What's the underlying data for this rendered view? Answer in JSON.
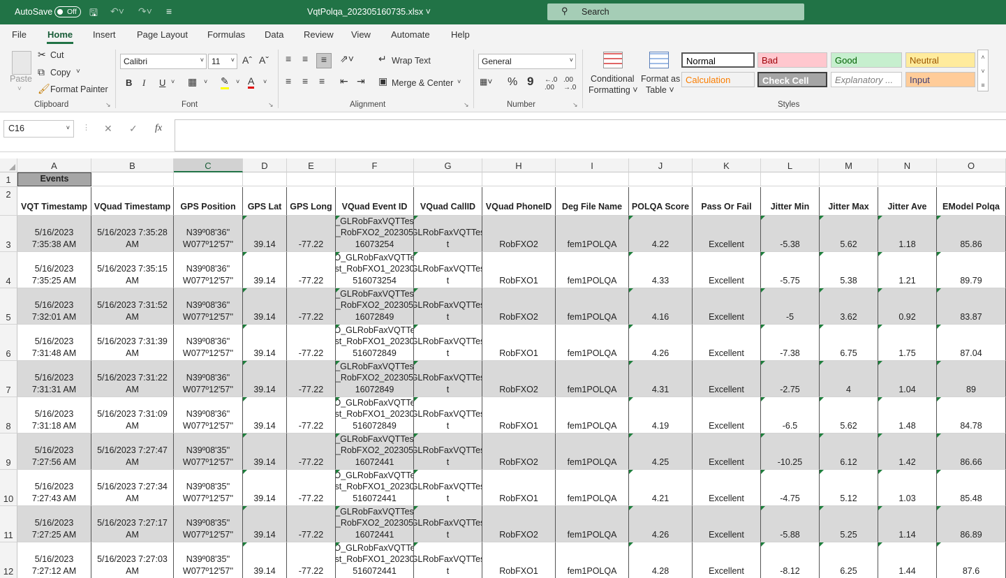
{
  "titlebar": {
    "autosave": "AutoSave",
    "toggle": "Off",
    "filename": "VqtPolqa_202305160735.xlsx",
    "search": "Search"
  },
  "tabs": [
    "File",
    "Home",
    "Insert",
    "Page Layout",
    "Formulas",
    "Data",
    "Review",
    "View",
    "Automate",
    "Help"
  ],
  "ribbon": {
    "paste": "Paste",
    "cut": "Cut",
    "copy": "Copy",
    "format_painter": "Format Painter",
    "clipboard": "Clipboard",
    "font_name": "Calibri",
    "font_size": "11",
    "font": "Font",
    "bold": "B",
    "italic": "I",
    "underline": "U",
    "wrap_text": "Wrap Text",
    "merge_center": "Merge & Center",
    "alignment": "Alignment",
    "number_format": "General",
    "percent": "%",
    "comma": "9",
    "number": "Number",
    "conditional": [
      "Conditional",
      "Formatting"
    ],
    "format_table": [
      "Format as",
      "Table"
    ],
    "styles": "Styles",
    "style_cells": [
      {
        "label": "Normal",
        "bg": "#ffffff",
        "color": "#000000"
      },
      {
        "label": "Bad",
        "bg": "#ffc7ce",
        "color": "#9c0006"
      },
      {
        "label": "Good",
        "bg": "#c6efce",
        "color": "#006100"
      },
      {
        "label": "Neutral",
        "bg": "#ffeb9c",
        "color": "#9c5700"
      },
      {
        "label": "Calculation",
        "bg": "#f2f2f2",
        "color": "#fa7d00"
      },
      {
        "label": "Check Cell",
        "bg": "#a5a5a5",
        "color": "#ffffff"
      },
      {
        "label": "Explanatory ...",
        "bg": "#ffffff",
        "color": "#7f7f7f"
      },
      {
        "label": "Input",
        "bg": "#ffcc99",
        "color": "#3f3f76"
      }
    ]
  },
  "formula": {
    "namebox": "C16",
    "fx": "fx"
  },
  "columns": [
    "A",
    "B",
    "C",
    "D",
    "E",
    "F",
    "G",
    "H",
    "I",
    "J",
    "K",
    "L",
    "M",
    "N",
    "O"
  ],
  "selected_column": "C",
  "row_numbers": [
    "1",
    "2",
    "3",
    "4",
    "5",
    "6",
    "7",
    "8",
    "9",
    "10",
    "11",
    "12"
  ],
  "title_cell": "Events",
  "headers": [
    "VQT Timestamp",
    "VQuad Timestamp",
    "GPS Position",
    "GPS Lat",
    "GPS Long",
    "VQuad Event ID",
    "VQuad CallID",
    "VQuad PhoneID",
    "Deg File Name",
    "POLQA Score",
    "Pass Or Fail",
    "Jitter Min",
    "Jitter Max",
    "Jitter Ave",
    "EModel Polqa"
  ],
  "rows": [
    [
      [
        "5/16/2023",
        "7:35:38 AM"
      ],
      [
        "5/16/2023 7:35:28",
        "AM"
      ],
      [
        "N39º08'36''",
        "W077º12'57''"
      ],
      [
        "39.14"
      ],
      [
        "-77.22"
      ],
      [
        "I_GLRobFaxVQTTest",
        "_RobFXO2_202305",
        "16073254"
      ],
      [
        "GLRobFaxVQTTes",
        "t"
      ],
      [
        "RobFXO2"
      ],
      [
        "fem1POLQA"
      ],
      [
        "4.22"
      ],
      [
        "Excellent"
      ],
      [
        "-5.38"
      ],
      [
        "5.62"
      ],
      [
        "1.18"
      ],
      [
        "85.86"
      ]
    ],
    [
      [
        "5/16/2023",
        "7:35:25 AM"
      ],
      [
        "5/16/2023 7:35:15",
        "AM"
      ],
      [
        "N39º08'36''",
        "W077º12'57''"
      ],
      [
        "39.14"
      ],
      [
        "-77.22"
      ],
      [
        "O_GLRobFaxVQTTe",
        "st_RobFXO1_20230",
        "516073254"
      ],
      [
        "GLRobFaxVQTTes",
        "t"
      ],
      [
        "RobFXO1"
      ],
      [
        "fem1POLQA"
      ],
      [
        "4.33"
      ],
      [
        "Excellent"
      ],
      [
        "-5.75"
      ],
      [
        "5.38"
      ],
      [
        "1.21"
      ],
      [
        "89.79"
      ]
    ],
    [
      [
        "5/16/2023",
        "7:32:01 AM"
      ],
      [
        "5/16/2023 7:31:52",
        "AM"
      ],
      [
        "N39º08'36''",
        "W077º12'57''"
      ],
      [
        "39.14"
      ],
      [
        "-77.22"
      ],
      [
        "I_GLRobFaxVQTTest",
        "_RobFXO2_202305",
        "16072849"
      ],
      [
        "GLRobFaxVQTTes",
        "t"
      ],
      [
        "RobFXO2"
      ],
      [
        "fem1POLQA"
      ],
      [
        "4.16"
      ],
      [
        "Excellent"
      ],
      [
        "-5"
      ],
      [
        "3.62"
      ],
      [
        "0.92"
      ],
      [
        "83.87"
      ]
    ],
    [
      [
        "5/16/2023",
        "7:31:48 AM"
      ],
      [
        "5/16/2023 7:31:39",
        "AM"
      ],
      [
        "N39º08'36''",
        "W077º12'57''"
      ],
      [
        "39.14"
      ],
      [
        "-77.22"
      ],
      [
        "O_GLRobFaxVQTTe",
        "st_RobFXO1_20230",
        "516072849"
      ],
      [
        "GLRobFaxVQTTes",
        "t"
      ],
      [
        "RobFXO1"
      ],
      [
        "fem1POLQA"
      ],
      [
        "4.26"
      ],
      [
        "Excellent"
      ],
      [
        "-7.38"
      ],
      [
        "6.75"
      ],
      [
        "1.75"
      ],
      [
        "87.04"
      ]
    ],
    [
      [
        "5/16/2023",
        "7:31:31 AM"
      ],
      [
        "5/16/2023 7:31:22",
        "AM"
      ],
      [
        "N39º08'36''",
        "W077º12'57''"
      ],
      [
        "39.14"
      ],
      [
        "-77.22"
      ],
      [
        "I_GLRobFaxVQTTest",
        "_RobFXO2_202305",
        "16072849"
      ],
      [
        "GLRobFaxVQTTes",
        "t"
      ],
      [
        "RobFXO2"
      ],
      [
        "fem1POLQA"
      ],
      [
        "4.31"
      ],
      [
        "Excellent"
      ],
      [
        "-2.75"
      ],
      [
        "4"
      ],
      [
        "1.04"
      ],
      [
        "89"
      ]
    ],
    [
      [
        "5/16/2023",
        "7:31:18 AM"
      ],
      [
        "5/16/2023 7:31:09",
        "AM"
      ],
      [
        "N39º08'36''",
        "W077º12'57''"
      ],
      [
        "39.14"
      ],
      [
        "-77.22"
      ],
      [
        "O_GLRobFaxVQTTe",
        "st_RobFXO1_20230",
        "516072849"
      ],
      [
        "GLRobFaxVQTTes",
        "t"
      ],
      [
        "RobFXO1"
      ],
      [
        "fem1POLQA"
      ],
      [
        "4.19"
      ],
      [
        "Excellent"
      ],
      [
        "-6.5"
      ],
      [
        "5.62"
      ],
      [
        "1.48"
      ],
      [
        "84.78"
      ]
    ],
    [
      [
        "5/16/2023",
        "7:27:56 AM"
      ],
      [
        "5/16/2023 7:27:47",
        "AM"
      ],
      [
        "N39º08'35''",
        "W077º12'57''"
      ],
      [
        "39.14"
      ],
      [
        "-77.22"
      ],
      [
        "I_GLRobFaxVQTTest",
        "_RobFXO2_202305",
        "16072441"
      ],
      [
        "GLRobFaxVQTTes",
        "t"
      ],
      [
        "RobFXO2"
      ],
      [
        "fem1POLQA"
      ],
      [
        "4.25"
      ],
      [
        "Excellent"
      ],
      [
        "-10.25"
      ],
      [
        "6.12"
      ],
      [
        "1.42"
      ],
      [
        "86.66"
      ]
    ],
    [
      [
        "5/16/2023",
        "7:27:43 AM"
      ],
      [
        "5/16/2023 7:27:34",
        "AM"
      ],
      [
        "N39º08'35''",
        "W077º12'57''"
      ],
      [
        "39.14"
      ],
      [
        "-77.22"
      ],
      [
        "O_GLRobFaxVQTTe",
        "st_RobFXO1_20230",
        "516072441"
      ],
      [
        "GLRobFaxVQTTes",
        "t"
      ],
      [
        "RobFXO1"
      ],
      [
        "fem1POLQA"
      ],
      [
        "4.21"
      ],
      [
        "Excellent"
      ],
      [
        "-4.75"
      ],
      [
        "5.12"
      ],
      [
        "1.03"
      ],
      [
        "85.48"
      ]
    ],
    [
      [
        "5/16/2023",
        "7:27:25 AM"
      ],
      [
        "5/16/2023 7:27:17",
        "AM"
      ],
      [
        "N39º08'35''",
        "W077º12'57''"
      ],
      [
        "39.14"
      ],
      [
        "-77.22"
      ],
      [
        "I_GLRobFaxVQTTest",
        "_RobFXO2_202305",
        "16072441"
      ],
      [
        "GLRobFaxVQTTes",
        "t"
      ],
      [
        "RobFXO2"
      ],
      [
        "fem1POLQA"
      ],
      [
        "4.26"
      ],
      [
        "Excellent"
      ],
      [
        "-5.88"
      ],
      [
        "5.25"
      ],
      [
        "1.14"
      ],
      [
        "86.89"
      ]
    ],
    [
      [
        "5/16/2023",
        "7:27:12 AM"
      ],
      [
        "5/16/2023 7:27:03",
        "AM"
      ],
      [
        "N39º08'35''",
        "W077º12'57''"
      ],
      [
        "39.14"
      ],
      [
        "-77.22"
      ],
      [
        "O_GLRobFaxVQTTe",
        "st_RobFXO1_20230",
        "516072441"
      ],
      [
        "GLRobFaxVQTTes",
        "t"
      ],
      [
        "RobFXO1"
      ],
      [
        "fem1POLQA"
      ],
      [
        "4.28"
      ],
      [
        "Excellent"
      ],
      [
        "-8.12"
      ],
      [
        "6.25"
      ],
      [
        "1.44"
      ],
      [
        "87.6"
      ]
    ]
  ],
  "colors": {
    "excel_green": "#217346",
    "alt_row": "#d9d9d9",
    "header_gray": "#a6a6a6"
  }
}
